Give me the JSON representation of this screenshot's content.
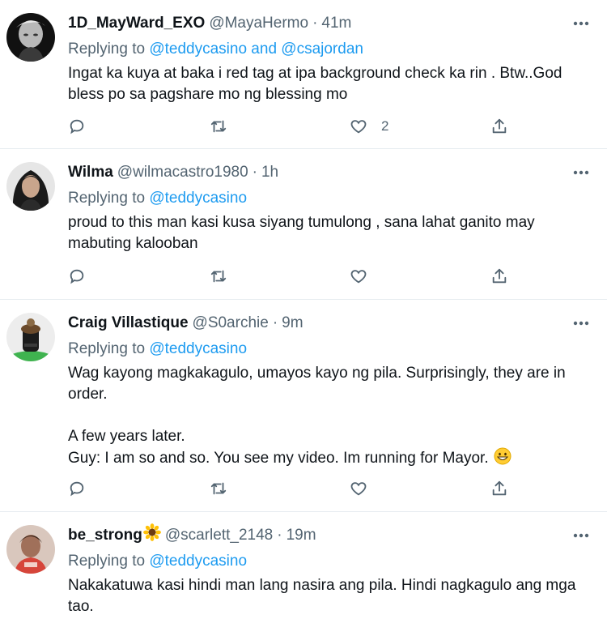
{
  "tweets": [
    {
      "name": "1D_MayWard_EXO",
      "handle": "@MayaHermo",
      "time": "41m",
      "replying_prefix": "Replying to ",
      "replying_to": "@teddycasino and @csajordan",
      "text": "Ingat ka kuya at baka i red tag at ipa background check ka rin . Btw..God bless po sa pagshare mo ng blessing mo",
      "like_count": "2"
    },
    {
      "name": "Wilma",
      "handle": "@wilmacastro1980",
      "time": "1h",
      "replying_prefix": "Replying to ",
      "replying_to": "@teddycasino",
      "text": "proud to this man kasi kusa siyang tumulong , sana lahat ganito may mabuting kalooban",
      "like_count": ""
    },
    {
      "name": "Craig Villastique",
      "handle": "@S0archie",
      "time": "9m",
      "replying_prefix": "Replying to ",
      "replying_to": "@teddycasino",
      "text": "Wag kayong magkakagulo, umayos kayo ng pila. Surprisingly, they are in order.\n\nA few years later.\nGuy: I am so and so. You see my video. Im running for Mayor. ",
      "like_count": ""
    },
    {
      "name": "be_strong",
      "handle": "@scarlett_2148",
      "time": "19m",
      "replying_prefix": "Replying to ",
      "replying_to": "@teddycasino",
      "text": "Nakakatuwa kasi hindi man lang nasira ang pila. Hindi nagkagulo ang mga tao.",
      "like_count": ""
    }
  ],
  "separator": "·",
  "icons": {
    "more": "more-dots-icon",
    "reply": "reply-bubble-icon",
    "retweet": "retweet-icon",
    "like": "heart-icon",
    "share": "share-icon",
    "grin": "grinning-emoji-icon",
    "sunflower": "sunflower-emoji-icon"
  },
  "colors": {
    "accent": "#1d9bf0",
    "secondary_text": "#536471",
    "divider": "#e6ecf0"
  }
}
